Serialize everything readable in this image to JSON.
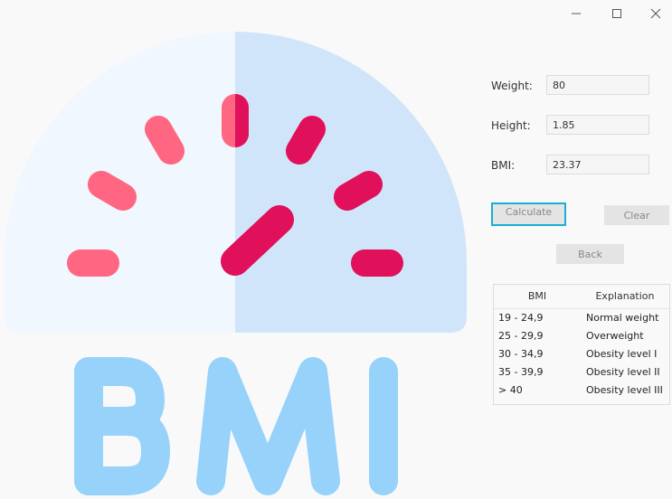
{
  "window": {
    "controls": [
      "minimize-icon",
      "maximize-icon",
      "close-icon"
    ]
  },
  "logo": {
    "text": "BMI",
    "colors": {
      "dial_light": "#f1f7fe",
      "dial_dark": "#d1e5fa",
      "tick_light": "#ff6681",
      "tick_dark": "#e0105a",
      "letters": "#97d2fb"
    }
  },
  "form": {
    "weight_label": "Weight:",
    "weight_value": "80",
    "height_label": "Height:",
    "height_value": "1.85",
    "bmi_label": "BMI:",
    "bmi_value": "23.37"
  },
  "buttons": {
    "calculate": "Calculate",
    "clear": "Clear",
    "back": "Back"
  },
  "table": {
    "headers": [
      "BMI",
      "Explanation"
    ],
    "rows": [
      [
        "19 - 24,9",
        "Normal weight"
      ],
      [
        "25 - 29,9",
        "Overweight"
      ],
      [
        "30 - 34,9",
        "Obesity level I"
      ],
      [
        "35 - 39,9",
        "Obesity level II"
      ],
      [
        "> 40",
        "Obesity level III"
      ]
    ]
  },
  "theme": {
    "focus_border": "#19aed3"
  }
}
